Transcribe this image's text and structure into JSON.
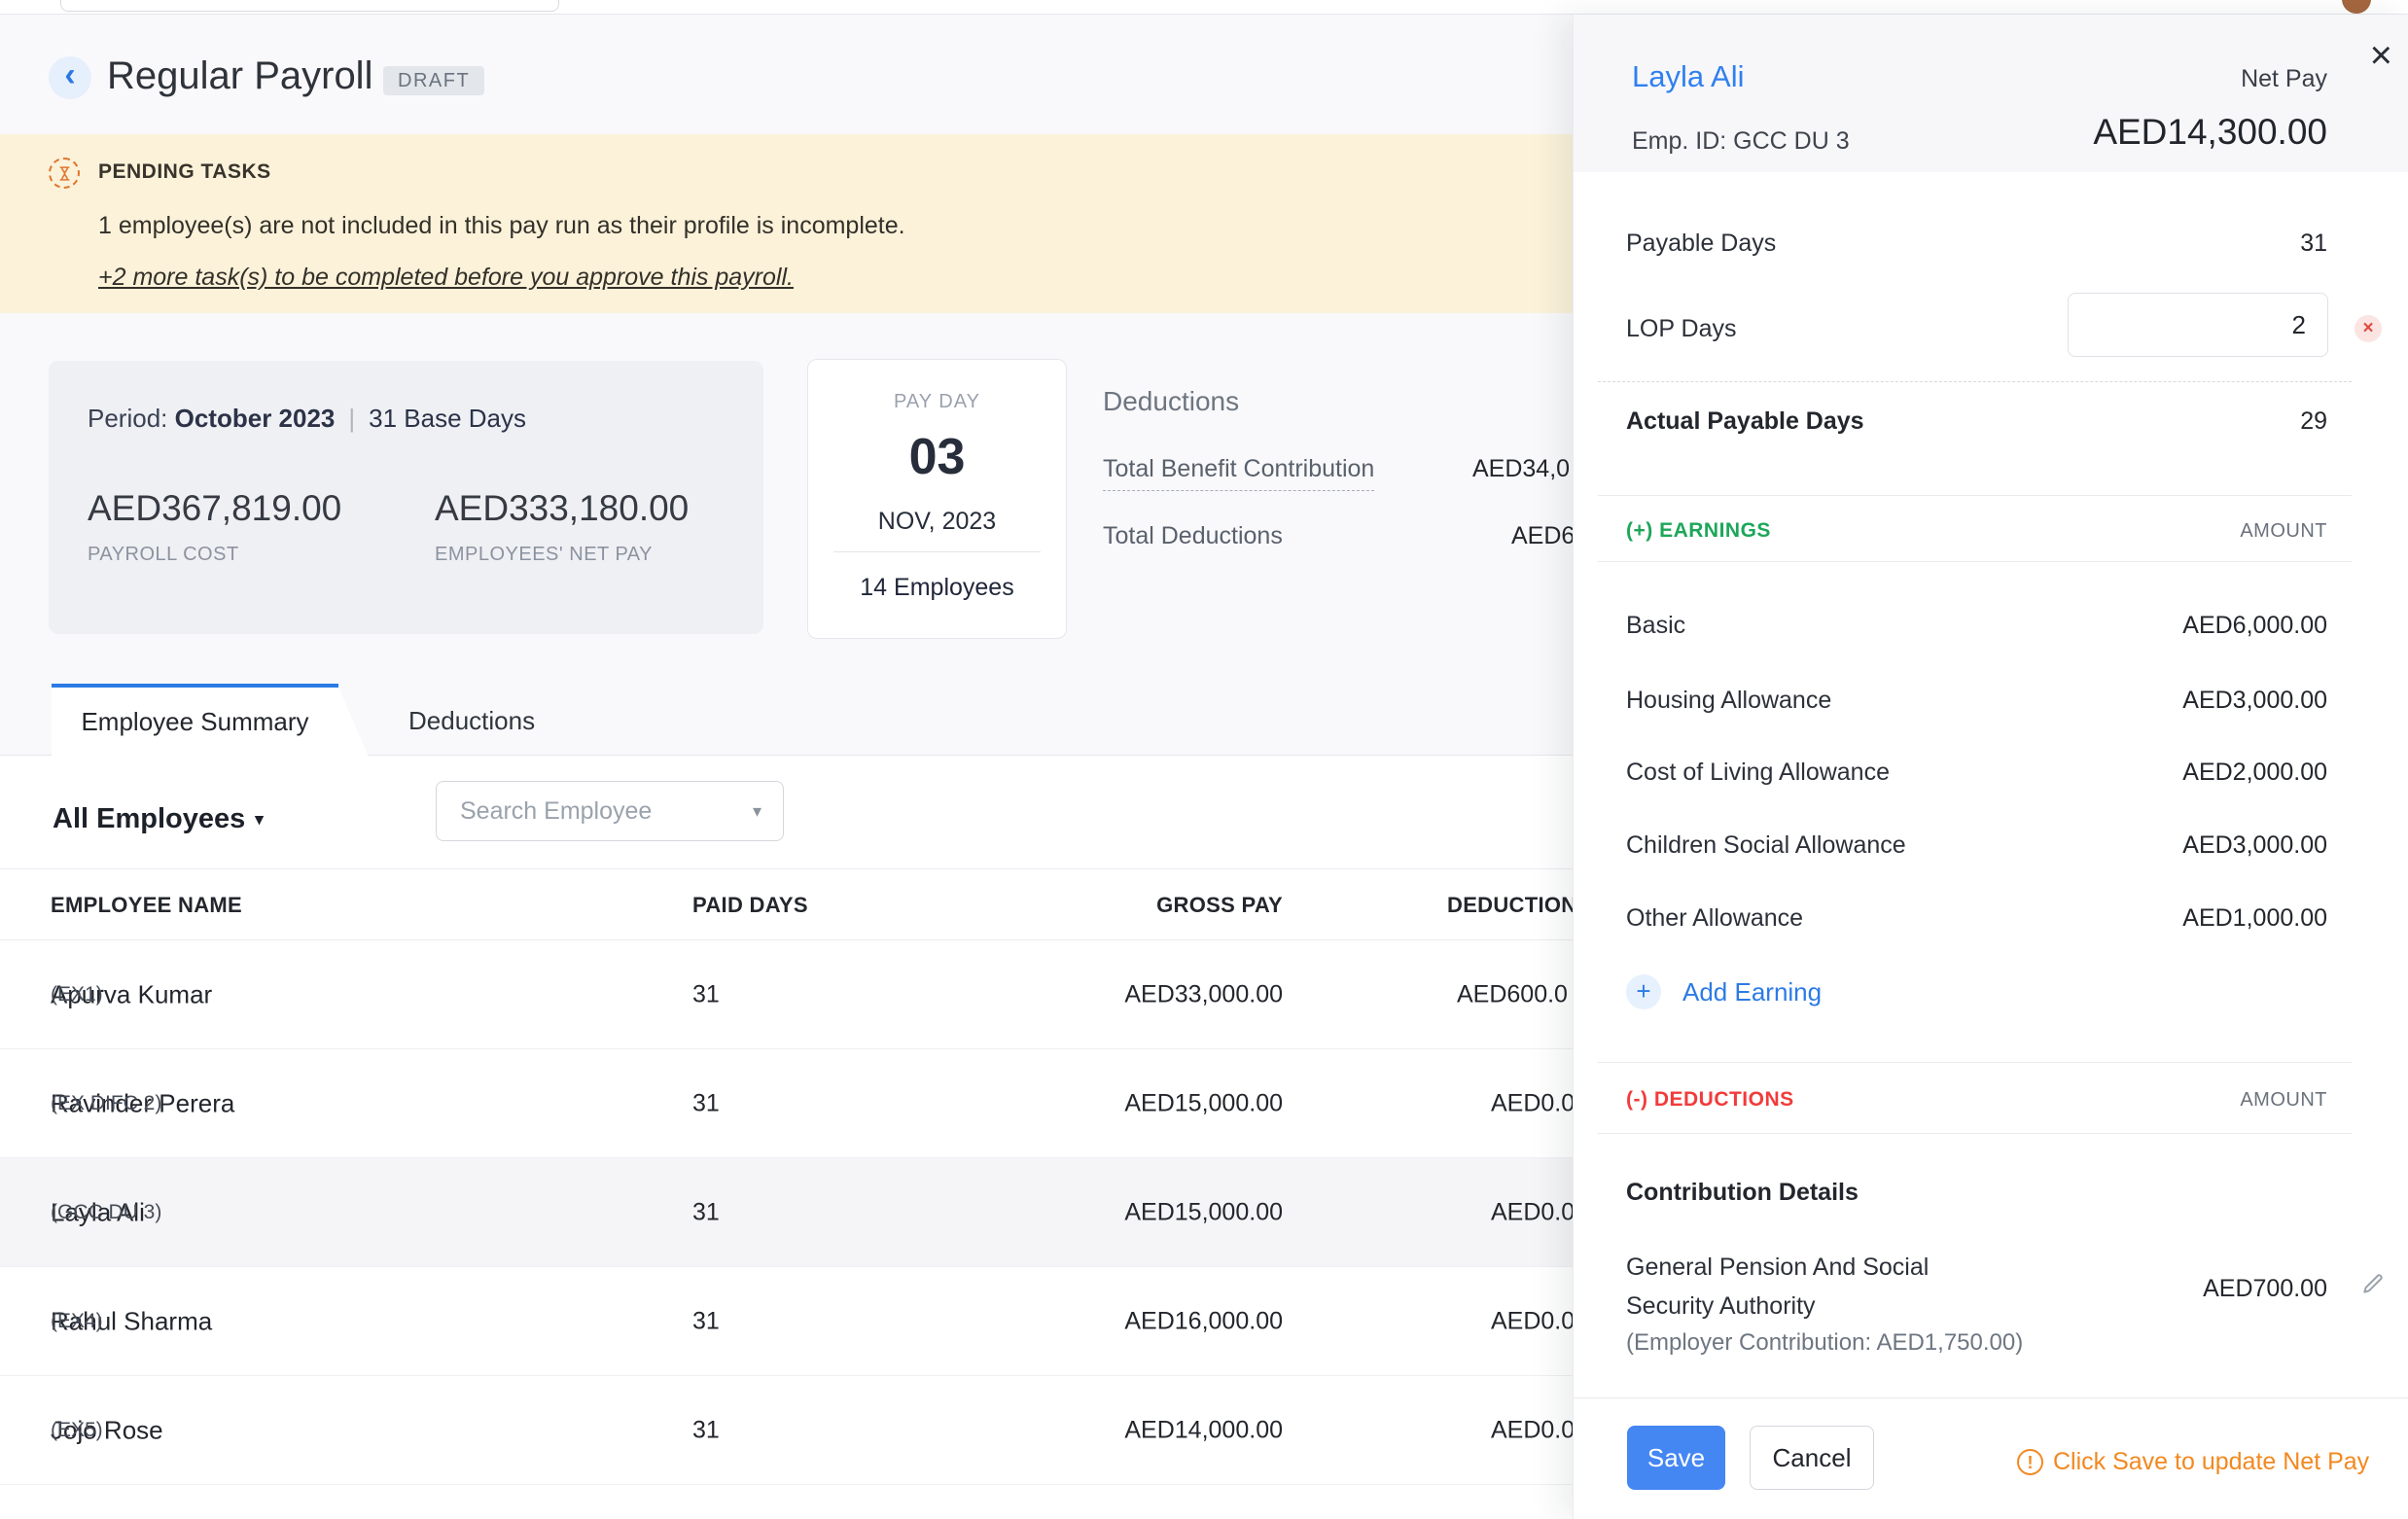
{
  "colors": {
    "accent_blue": "#2c7be5",
    "link_blue": "#3080ef",
    "save_blue": "#4486f2",
    "green": "#1da65a",
    "red": "#f23b3b",
    "orange": "#f2881f",
    "banner_bg": "#fbf2d9",
    "banner_orange": "#e0762e",
    "row_highlight": "#f5f5f7",
    "panel_header_bg": "#f7f7fa",
    "card_bg": "#eef0f4"
  },
  "icons": {
    "back_chevron": "‹",
    "dropdown_caret": "▾",
    "select_caret": "▾",
    "close": "×",
    "clear_x": "×",
    "plus": "+",
    "warning_bang": "!"
  },
  "header": {
    "title": "Regular Payroll",
    "status": "DRAFT"
  },
  "banner": {
    "heading": "PENDING TASKS",
    "message": "1 employee(s) are not included in this pay run as their profile is incomplete.",
    "link": "+2 more task(s) to be completed before you approve this payroll."
  },
  "period_card": {
    "label_prefix": "Period:",
    "period": "October 2023",
    "base_days": "31 Base Days",
    "payroll_cost": "AED367,819.00",
    "payroll_cost_label": "PAYROLL COST",
    "employees_net_pay": "AED333,180.00",
    "employees_net_pay_label": "EMPLOYEES' NET PAY"
  },
  "payday_card": {
    "label": "PAY DAY",
    "day": "03",
    "month_year": "NOV, 2023",
    "employees": "14 Employees"
  },
  "deductions_summary": {
    "heading": "Deductions",
    "rows": [
      {
        "label": "Total Benefit Contribution",
        "value": "AED34,0"
      },
      {
        "label": "Total Deductions",
        "value": "AED6"
      }
    ]
  },
  "tabs": [
    {
      "label": "Employee Summary"
    },
    {
      "label": "Deductions"
    }
  ],
  "toolbar": {
    "employee_filter": "All Employees",
    "search_placeholder": "Search Employee"
  },
  "table": {
    "columns": [
      "EMPLOYEE NAME",
      "PAID DAYS",
      "GROSS PAY",
      "DEDUCTIONS"
    ],
    "rows": [
      {
        "name": "Apurva Kumar",
        "id": "(EX1)",
        "paid_days": "31",
        "gross": "AED33,000.00",
        "deduction": "AED600.0"
      },
      {
        "name": "Ravinder Perera",
        "id": "(EX DIFC 2)",
        "paid_days": "31",
        "gross": "AED15,000.00",
        "deduction": "AED0.0"
      },
      {
        "name": "Layla Ali",
        "id": "(GCC DU 3)",
        "paid_days": "31",
        "gross": "AED15,000.00",
        "deduction": "AED0.0"
      },
      {
        "name": "Rahul Sharma",
        "id": "(EX4)",
        "paid_days": "31",
        "gross": "AED16,000.00",
        "deduction": "AED0.0"
      },
      {
        "name": "Jojo Rose",
        "id": "(EX5)",
        "paid_days": "31",
        "gross": "AED14,000.00",
        "deduction": "AED0.0"
      }
    ]
  },
  "panel": {
    "employee_name": "Layla Ali",
    "net_pay_label": "Net Pay",
    "emp_id": "Emp. ID: GCC DU 3",
    "net_pay": "AED14,300.00",
    "payable_days_label": "Payable Days",
    "payable_days": "31",
    "lop_days_label": "LOP Days",
    "lop_days": "2",
    "actual_payable_label": "Actual Payable Days",
    "actual_payable": "29",
    "earnings": {
      "heading": "(+) EARNINGS",
      "amount_label": "AMOUNT",
      "rows": [
        [
          "Basic",
          "AED6,000.00"
        ],
        [
          "Housing Allowance",
          "AED3,000.00"
        ],
        [
          "Cost of Living Allowance",
          "AED2,000.00"
        ],
        [
          "Children Social Allowance",
          "AED3,000.00"
        ],
        [
          "Other Allowance",
          "AED1,000.00"
        ]
      ],
      "add_label": "Add Earning"
    },
    "deductions": {
      "heading": "(-) DEDUCTIONS",
      "amount_label": "AMOUNT",
      "sub_heading": "Contribution Details",
      "row_label_line1": "General Pension And Social",
      "row_label_line2": "Security Authority",
      "row_sub": "(Employer Contribution: AED1,750.00)",
      "value": "AED700.00"
    },
    "footer": {
      "save": "Save",
      "cancel": "Cancel",
      "warning": "Click Save to update Net Pay"
    }
  }
}
